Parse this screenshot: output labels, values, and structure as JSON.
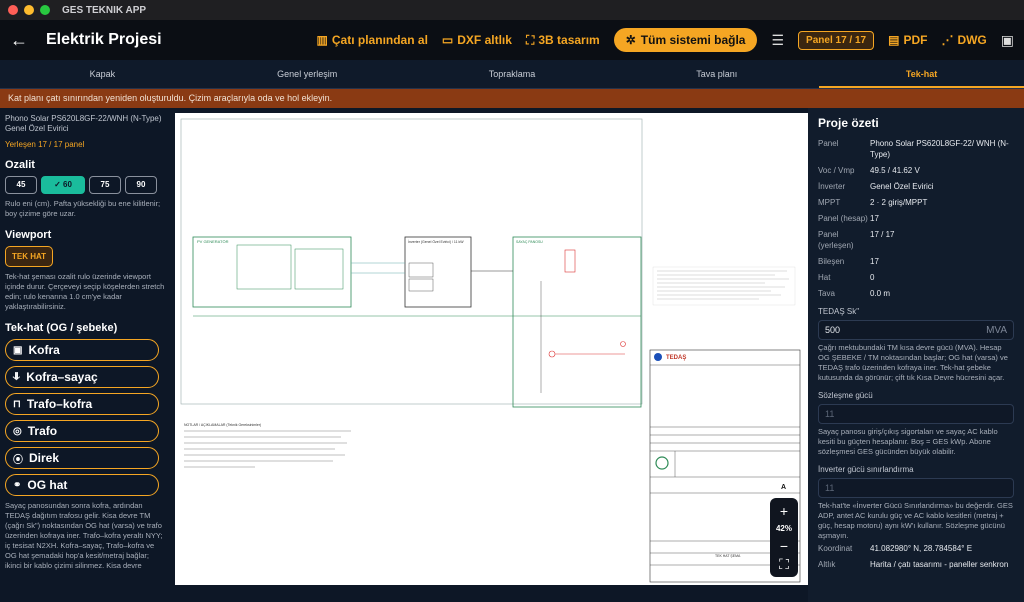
{
  "app": {
    "title": "GES TEKNIK APP"
  },
  "header": {
    "title": "Elektrik Projesi",
    "roof_plan": "Çatı planından al",
    "dxf": "DXF altlık",
    "design3d": "3B tasarım",
    "connect_all": "Tüm sistemi bağla",
    "panel_badge": "Panel 17 / 17",
    "pdf": "PDF",
    "dwg": "DWG"
  },
  "tabs": [
    "Kapak",
    "Genel yerleşim",
    "Topraklama",
    "Tava planı",
    "Tek-hat"
  ],
  "notice": "Kat planı çatı sınırından yeniden oluşturuldu. Çizim araçlarıyla oda ve hol ekleyin.",
  "left": {
    "panel_model": "Phono Solar PS620L8GF-22/WNH (N-Type)",
    "inverter": "Genel Özel Evirici",
    "placed": "Yerleşen 17 / 17 panel",
    "ozalit_title": "Ozalit",
    "ozalit_options": [
      "45",
      "60",
      "75",
      "90"
    ],
    "ozalit_help": "Rulo eni (cm). Pafta yüksekliği bu ene kilitlenir; boy çizime göre uzar.",
    "viewport_title": "Viewport",
    "tekhat_btn": "TEK HAT",
    "viewport_help": "Tek-hat şeması ozalit rulo üzerinde viewport içinde durur. Çerçeveyi seçip köşelerden stretch edin; rulo kenarına 1.0 cm'ye kadar yaklaştırabilirsiniz.",
    "og_title": "Tek-hat (OG / şebeke)",
    "og_items": [
      "Kofra",
      "Kofra–sayaç",
      "Trafo–kofra",
      "Trafo",
      "Direk",
      "OG hat"
    ],
    "og_help": "Sayaç panosundan sonra kofra, ardından TEDAŞ dağıtım trafosu gelir. Kisa devre TM (çağrı Sk\") noktasından OG hat (varsa) ve trafo üzerinden kofraya iner. Trafo–kofra yeraltı NYY; iç tesisat N2XH. Kofra–sayaç, Trafo–kofra ve OG hat şemadaki hop'a kesit/metraj bağlar; ikinci bir kablo çizimi silinmez. Kisa devre"
  },
  "zoom": {
    "in": "+",
    "pct": "42%",
    "out": "−"
  },
  "summary": {
    "title": "Proje özeti",
    "rows": [
      {
        "k": "Panel",
        "v": "Phono Solar PS620L8GF-22/ WNH (N-Type)"
      },
      {
        "k": "Voc / Vmp",
        "v": "49.5 / 41.62 V"
      },
      {
        "k": "İnverter",
        "v": "Genel Özel Evirici"
      },
      {
        "k": "MPPT",
        "v": "2 · 2 giriş/MPPT"
      },
      {
        "k": "Panel (hesap)",
        "v": "17"
      },
      {
        "k": "Panel (yerleşen)",
        "v": "17 / 17"
      },
      {
        "k": "Bileşen",
        "v": "17"
      },
      {
        "k": "Hat",
        "v": "0"
      },
      {
        "k": "Tava",
        "v": "0.0 m"
      }
    ],
    "sk_label": "TEDAŞ Sk\"",
    "sk_value": "500",
    "sk_unit": "MVA",
    "sk_help": "Çağrı mektubundaki TM kısa devre gücü (MVA). Hesap OG ŞEBEKE / TM noktasından başlar; OG hat (varsa) ve TEDAŞ trafo üzerinden kofraya iner. Tek-hat şebeke kutusunda da görünür; çift tık Kısa Devre hücresini açar.",
    "contract_label": "Sözleşme gücü",
    "contract_placeholder": "11",
    "contract_help": "Sayaç panosu giriş/çıkış sigortaları ve sayaç AC kablo kesiti bu güçten hesaplanır. Boş = GES kWp. Abone sözleşmesi GES gücünden büyük olabilir.",
    "limit_label": "İnverter gücü sınırlandırma",
    "limit_placeholder": "11",
    "limit_help": "Tek-hat'te «İnverter Gücü Sınırlandırma» bu değerdir. GES ADP, antet AC kurulu güç ve AC kablo kesitleri (metraj + güç, hesap motoru) aynı kW'ı kullanır. Sözleşme gücünü aşmayın.",
    "coord_label": "Koordinat",
    "coord_value": "41.082980° N, 28.784584° E",
    "source_label": "Altlık",
    "source_value": "Harita / çatı tasarımı - paneller senkron"
  },
  "drawing": {
    "pv_title": "PV GENERATÖR",
    "inv_title": "İnverter (Genel Özel Evirici) / 11 kW",
    "meter_title": "SAYAÇ PANOSU",
    "tedas": "TEDAŞ",
    "rev": "A",
    "notes_title": "NOTLAR / AÇIKLAMALAR (Teknik Gereksinimler)",
    "sheet_label": "TEK HAT ŞEMA"
  },
  "colors": {
    "accent": "#f5a623",
    "teal": "#1abc9c",
    "notice": "#8a3a13"
  }
}
